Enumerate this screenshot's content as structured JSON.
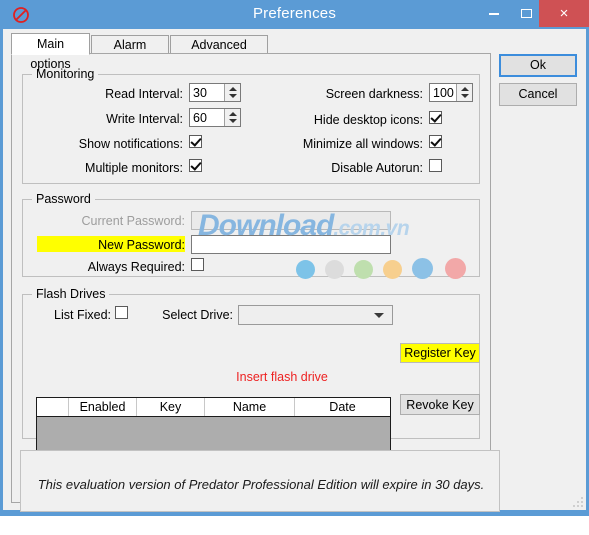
{
  "window": {
    "title": "Preferences",
    "icon": "prohibition-icon",
    "controls": {
      "minimize": "minimize-icon",
      "maximize": "maximize-icon",
      "close": "×"
    },
    "close_color": "#cf5154",
    "titlebar_color": "#5b9bd5"
  },
  "tabs": [
    {
      "label": "Main options",
      "active": true
    },
    {
      "label": "Alarm options",
      "active": false
    },
    {
      "label": "Advanced options",
      "active": false
    }
  ],
  "dialog_buttons": {
    "ok": "Ok",
    "cancel": "Cancel"
  },
  "monitoring": {
    "title": "Monitoring",
    "read_interval": {
      "label": "Read Interval:",
      "value": "30"
    },
    "write_interval": {
      "label": "Write Interval:",
      "value": "60"
    },
    "show_notifications": {
      "label": "Show notifications:",
      "checked": true
    },
    "multiple_monitors": {
      "label": "Multiple monitors:",
      "checked": true
    },
    "screen_darkness": {
      "label": "Screen darkness:",
      "value": "100"
    },
    "hide_desktop_icons": {
      "label": "Hide desktop icons:",
      "checked": true
    },
    "minimize_all_windows": {
      "label": "Minimize all windows:",
      "checked": true
    },
    "disable_autorun": {
      "label": "Disable Autorun:",
      "checked": false
    }
  },
  "password": {
    "title": "Password",
    "current_password": {
      "label": "Current Password:",
      "value": "",
      "disabled": true
    },
    "new_password": {
      "label": "New Password:",
      "value": "",
      "highlighted": true
    },
    "always_required": {
      "label": "Always Required:",
      "checked": false
    }
  },
  "flash_drives": {
    "title": "Flash Drives",
    "list_fixed": {
      "label": "List Fixed:",
      "checked": false
    },
    "select_drive": {
      "label": "Select Drive:",
      "value": "",
      "placeholder": ""
    },
    "register_key_button": "Register Key",
    "revoke_key_button": "Revoke Key",
    "hint": "Insert flash drive",
    "hint_color": "#ee2222",
    "table": {
      "columns": [
        "",
        "Enabled",
        "Key",
        "Name",
        "Date"
      ],
      "rows": []
    }
  },
  "evaluation": {
    "notice": "This evaluation version of Predator Professional Edition will expire in 30 days."
  },
  "watermark": {
    "primary": "Download",
    "suffix": ".com.vn",
    "dots": [
      "#7dc3e8",
      "#dcdcdc",
      "#bfdfae",
      "#f7cf8e",
      "#8cc1e6",
      "#f2a8a8"
    ]
  }
}
